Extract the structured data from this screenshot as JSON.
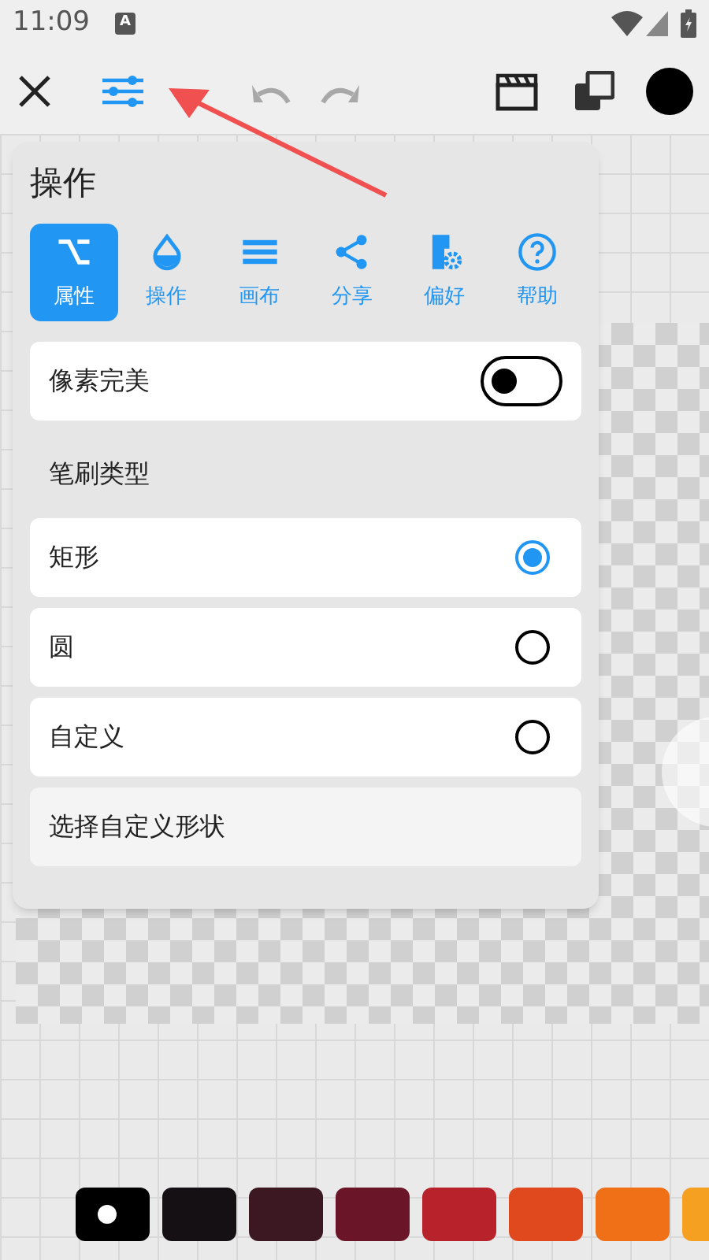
{
  "status_bar": {
    "time": "11:09",
    "notification": "A"
  },
  "toolbar": {
    "undo_disabled": true,
    "redo_disabled": true
  },
  "panel": {
    "title": "操作",
    "tabs": [
      {
        "label": "属性",
        "selected": true,
        "kind": "properties"
      },
      {
        "label": "操作",
        "selected": false,
        "kind": "drop"
      },
      {
        "label": "画布",
        "selected": false,
        "kind": "canvas"
      },
      {
        "label": "分享",
        "selected": false,
        "kind": "share"
      },
      {
        "label": "偏好",
        "selected": false,
        "kind": "prefs"
      },
      {
        "label": "帮助",
        "selected": false,
        "kind": "help"
      }
    ],
    "pixel_perfect": {
      "label": "像素完美",
      "on": false
    },
    "brush_type_heading": "笔刷类型",
    "brush_types": [
      {
        "label": "矩形",
        "selected": true
      },
      {
        "label": "圆",
        "selected": false
      },
      {
        "label": "自定义",
        "selected": false
      }
    ],
    "custom_shape_button": "选择自定义形状"
  },
  "palette": [
    {
      "color": "#000000",
      "selected": true
    },
    {
      "color": "#141014",
      "selected": false
    },
    {
      "color": "#3c1822",
      "selected": false
    },
    {
      "color": "#6b1628",
      "selected": false
    },
    {
      "color": "#b8222a",
      "selected": false
    },
    {
      "color": "#e0481e",
      "selected": false
    },
    {
      "color": "#f07018",
      "selected": false
    },
    {
      "color": "#f5a020",
      "selected": false
    }
  ]
}
